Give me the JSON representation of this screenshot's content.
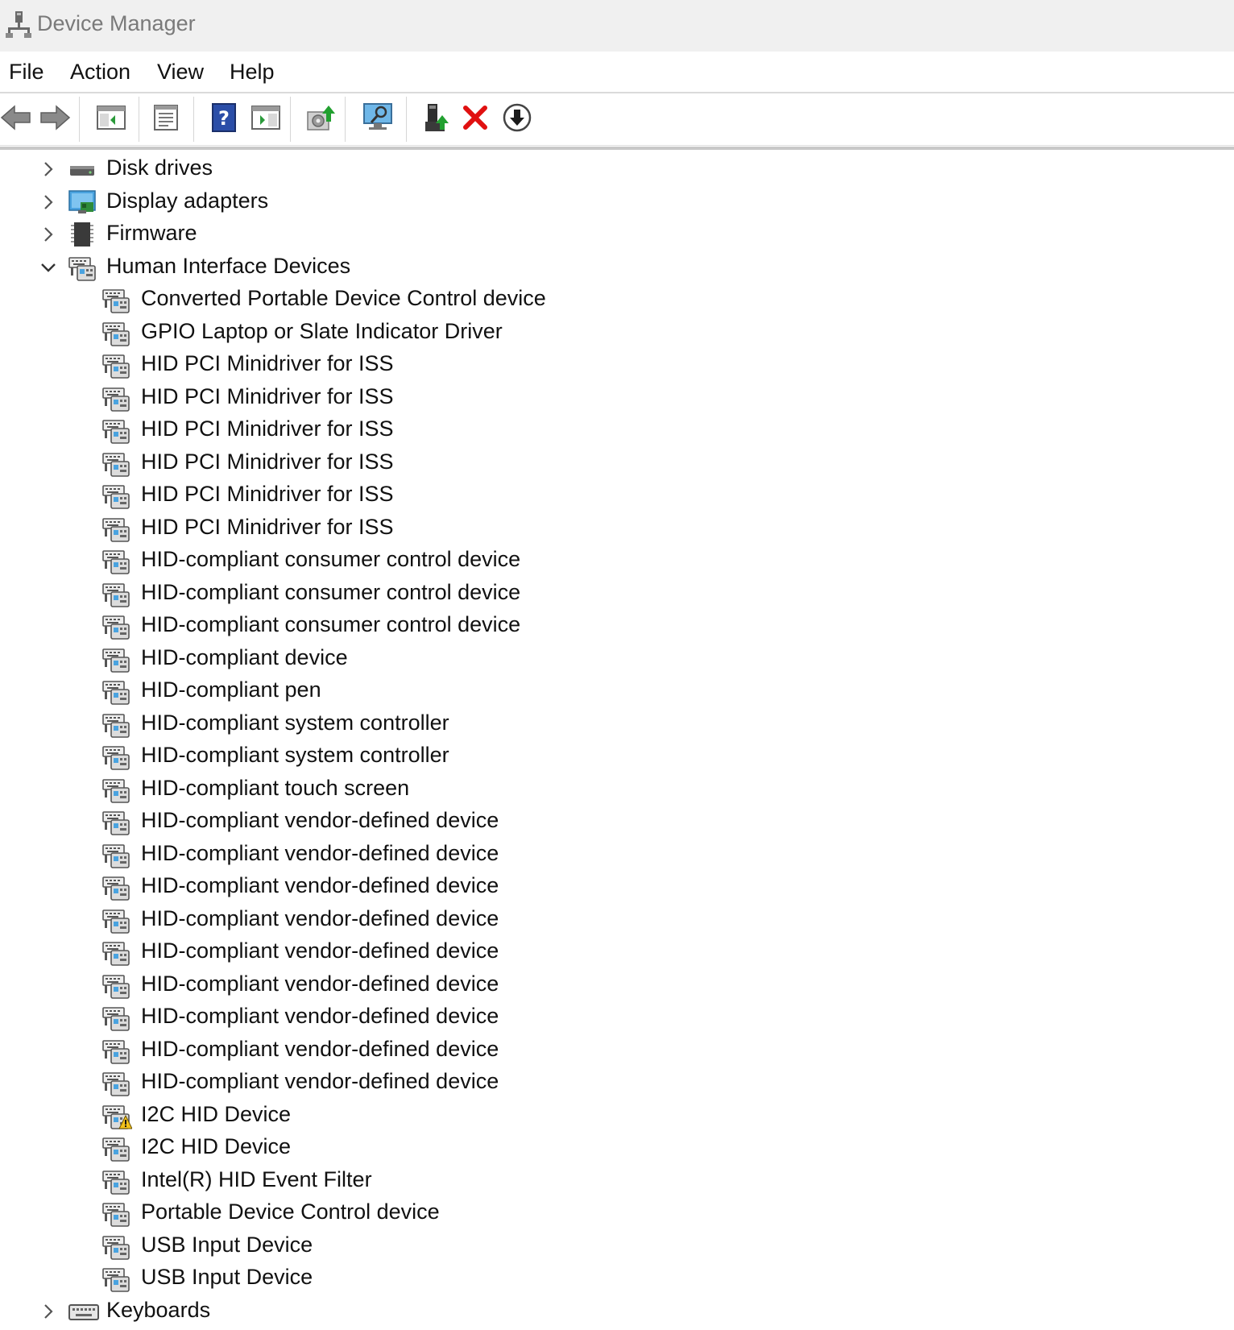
{
  "window": {
    "title": "Device Manager"
  },
  "menu": {
    "file": "File",
    "action": "Action",
    "view": "View",
    "help": "Help"
  },
  "toolbar": {
    "buttons": [
      "back-icon",
      "forward-icon",
      "show-hide-console-tree-icon",
      "properties-icon",
      "help-icon",
      "show-action-pane-icon",
      "update-driver-icon",
      "scan-hardware-icon",
      "enable-device-icon",
      "uninstall-device-icon",
      "disable-device-icon"
    ],
    "colors": {
      "uninstall": "#e01010",
      "help": "#2b4ea8",
      "update": "#22a030"
    }
  },
  "tree": {
    "categories_before": [
      {
        "label": "Disk drives",
        "icon": "disk-drive-icon",
        "expanded": false
      },
      {
        "label": "Display adapters",
        "icon": "display-adapter-icon",
        "expanded": false
      },
      {
        "label": "Firmware",
        "icon": "firmware-chip-icon",
        "expanded": false
      }
    ],
    "expanded_category": {
      "label": "Human Interface Devices",
      "icon": "hid-icon",
      "expanded": true
    },
    "devices": [
      {
        "label": "Converted Portable Device Control device",
        "warning": false
      },
      {
        "label": "GPIO Laptop or Slate Indicator Driver",
        "warning": false
      },
      {
        "label": "HID PCI Minidriver for ISS",
        "warning": false
      },
      {
        "label": "HID PCI Minidriver for ISS",
        "warning": false
      },
      {
        "label": "HID PCI Minidriver for ISS",
        "warning": false
      },
      {
        "label": "HID PCI Minidriver for ISS",
        "warning": false
      },
      {
        "label": "HID PCI Minidriver for ISS",
        "warning": false
      },
      {
        "label": "HID PCI Minidriver for ISS",
        "warning": false
      },
      {
        "label": "HID-compliant consumer control device",
        "warning": false
      },
      {
        "label": "HID-compliant consumer control device",
        "warning": false
      },
      {
        "label": "HID-compliant consumer control device",
        "warning": false
      },
      {
        "label": "HID-compliant device",
        "warning": false
      },
      {
        "label": "HID-compliant pen",
        "warning": false
      },
      {
        "label": "HID-compliant system controller",
        "warning": false
      },
      {
        "label": "HID-compliant system controller",
        "warning": false
      },
      {
        "label": "HID-compliant touch screen",
        "warning": false
      },
      {
        "label": "HID-compliant vendor-defined device",
        "warning": false
      },
      {
        "label": "HID-compliant vendor-defined device",
        "warning": false
      },
      {
        "label": "HID-compliant vendor-defined device",
        "warning": false
      },
      {
        "label": "HID-compliant vendor-defined device",
        "warning": false
      },
      {
        "label": "HID-compliant vendor-defined device",
        "warning": false
      },
      {
        "label": "HID-compliant vendor-defined device",
        "warning": false
      },
      {
        "label": "HID-compliant vendor-defined device",
        "warning": false
      },
      {
        "label": "HID-compliant vendor-defined device",
        "warning": false
      },
      {
        "label": "HID-compliant vendor-defined device",
        "warning": false
      },
      {
        "label": "I2C HID Device",
        "warning": true
      },
      {
        "label": "I2C HID Device",
        "warning": false
      },
      {
        "label": "Intel(R) HID Event Filter",
        "warning": false
      },
      {
        "label": "Portable Device Control device",
        "warning": false
      },
      {
        "label": "USB Input Device",
        "warning": false
      },
      {
        "label": "USB Input Device",
        "warning": false
      }
    ],
    "categories_after": [
      {
        "label": "Keyboards",
        "icon": "keyboard-icon",
        "expanded": false
      }
    ]
  }
}
